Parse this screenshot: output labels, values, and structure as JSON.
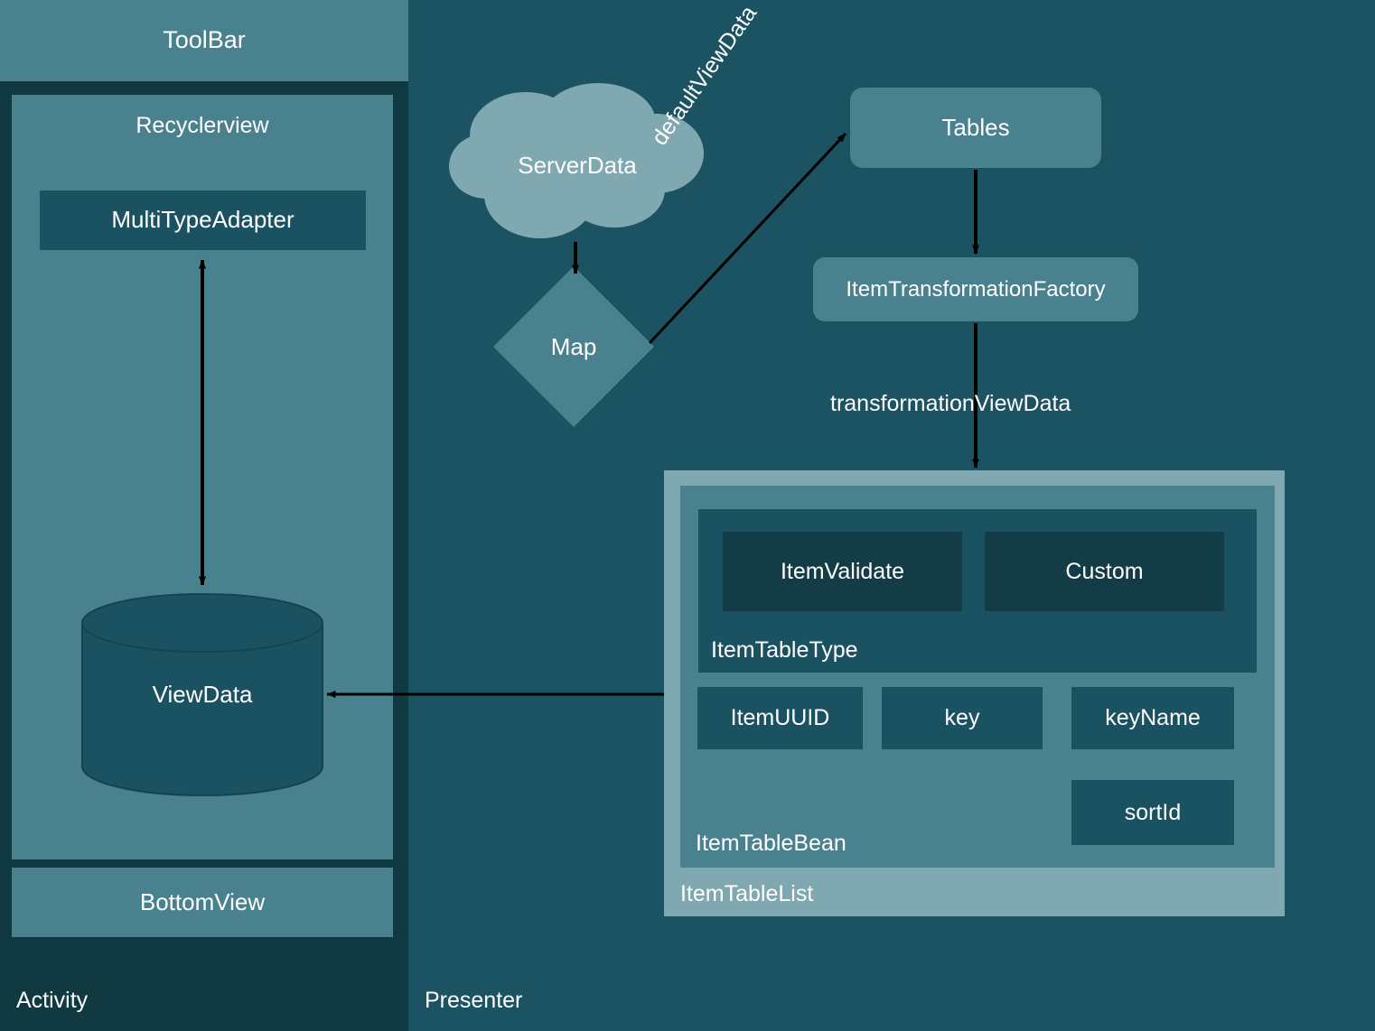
{
  "panes": {
    "activity": {
      "label": "Activity",
      "bg": "#103942"
    },
    "presenter": {
      "label": "Presenter",
      "bg": "#1c5363"
    }
  },
  "activity": {
    "toolbar": {
      "label": "ToolBar"
    },
    "recyclerview": {
      "label": "Recyclerview"
    },
    "multi_type_adapter": {
      "label": "MultiTypeAdapter"
    },
    "view_data": {
      "label": "ViewData",
      "shape": "cylinder"
    },
    "bottom_view": {
      "label": "BottomView"
    }
  },
  "presenter": {
    "server_data": {
      "label": "ServerData",
      "shape": "cloud"
    },
    "map": {
      "label": "Map",
      "shape": "diamond"
    },
    "tables": {
      "label": "Tables"
    },
    "item_transformation_factory": {
      "label": "ItemTransformationFactory"
    },
    "item_table_list": {
      "label": "ItemTableList",
      "item_table_bean": {
        "label": "ItemTableBean",
        "item_table_type": {
          "label": "ItemTableType",
          "children": [
            {
              "label": "ItemValidate"
            },
            {
              "label": "Custom"
            }
          ]
        },
        "fields": [
          {
            "label": "ItemUUID"
          },
          {
            "label": "key"
          },
          {
            "label": "keyName"
          },
          {
            "label": "sortId"
          }
        ]
      }
    }
  },
  "edges": [
    {
      "label": "defaultViewData",
      "from": "Map",
      "to": "Tables"
    },
    {
      "label": "transformationViewData",
      "from": "ItemTransformationFactory",
      "to": "ItemTableList"
    },
    {
      "label": "",
      "from": "ServerData",
      "to": "Map"
    },
    {
      "label": "",
      "from": "Tables",
      "to": "ItemTransformationFactory"
    },
    {
      "label": "",
      "from": "ViewData",
      "to": "MultiTypeAdapter"
    },
    {
      "label": "",
      "from": "MultiTypeAdapter",
      "to": "ViewData"
    },
    {
      "label": "",
      "from": "ItemTableList",
      "to": "ViewData"
    }
  ],
  "colors": {
    "background": "#1c5363",
    "activity_pane": "#103942",
    "box_mid": "#4a818f",
    "box_dark": "#1b5262",
    "box_darker": "#143c47",
    "box_light": "#7fa8b0",
    "arrow": "#000000",
    "text": "#ffffff"
  }
}
